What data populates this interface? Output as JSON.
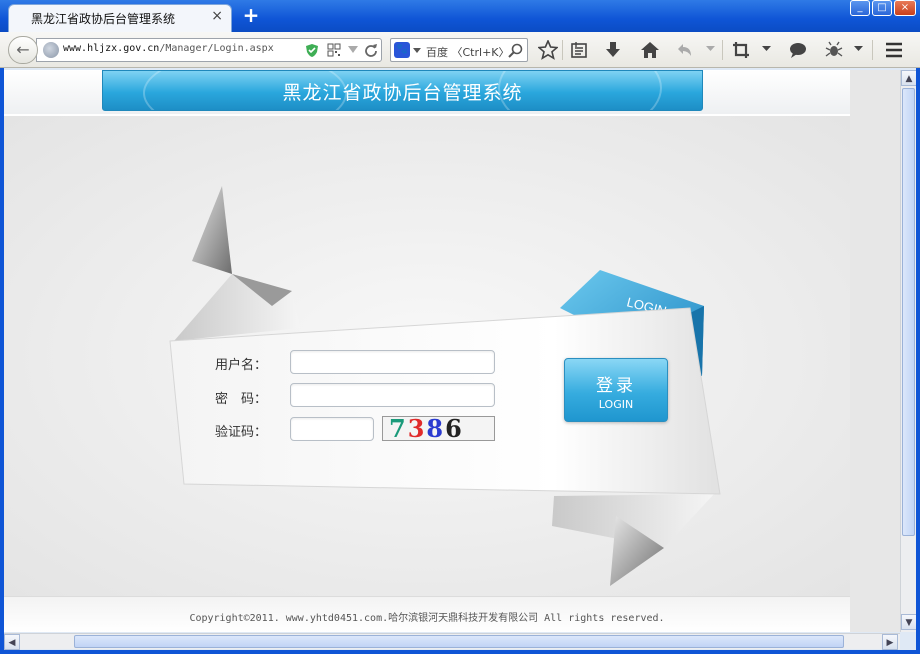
{
  "window": {
    "tab_title": "黑龙江省政协后台管理系统",
    "tab_close": "×",
    "new_tab": "+",
    "min": "_",
    "max": "□",
    "close": "×"
  },
  "navbar": {
    "back": "←",
    "url_host": "www.hljzx.gov.cn",
    "url_path": "/Manager/Login.aspx",
    "search_engine_icon": "baidu-paw-icon",
    "search_placeholder": "百度 〈Ctrl+K〉",
    "icons": [
      "shield-icon",
      "qr-icon",
      "dropdown-icon",
      "reload-icon",
      "search-icon",
      "star-icon",
      "reading-list-icon",
      "download-icon",
      "home-icon",
      "undo-icon",
      "crop-icon",
      "chat-icon",
      "bug-icon",
      "menu-icon"
    ]
  },
  "page": {
    "banner_title": "黑龙江省政协后台管理系统",
    "ribbon_tag": "LOGIN",
    "form": {
      "username_label": "用户名：",
      "password_label": "密　码：",
      "captcha_label": "验证码：",
      "username_value": "",
      "password_value": "",
      "captcha_value": "",
      "captcha_chars": [
        "7",
        "3",
        "8",
        "6"
      ]
    },
    "login_button": {
      "cn": "登录",
      "en": "LOGIN"
    },
    "footer": "Copyright©2011. www.yhtd0451.com.哈尔滨银河天鼎科技开发有限公司 All rights reserved."
  },
  "colors": {
    "accent": "#2aa7dd",
    "titlebar": "#0f55d6"
  }
}
